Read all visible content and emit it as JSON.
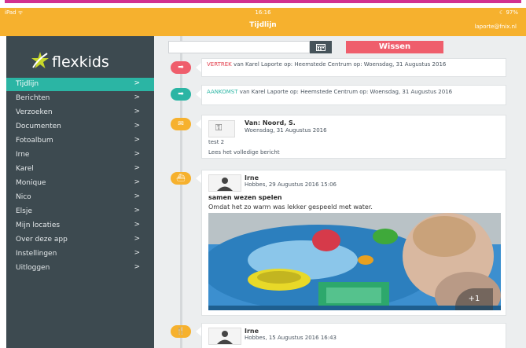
{
  "status": {
    "left": "iPad ᯤ",
    "time": "16:16",
    "right": "☾ 97%"
  },
  "header": {
    "title": "Tijdlijn",
    "email": "laporte@fnix.nl"
  },
  "brand": {
    "name": "flexkids",
    "star_color": "#c8d82a"
  },
  "nav": {
    "items": [
      {
        "label": "Tijdlijn",
        "active": true
      },
      {
        "label": "Berichten"
      },
      {
        "label": "Verzoeken"
      },
      {
        "label": "Documenten"
      },
      {
        "label": "Fotoalbum"
      },
      {
        "label": "Irne"
      },
      {
        "label": "Karel"
      },
      {
        "label": "Monique"
      },
      {
        "label": "Nico"
      },
      {
        "label": "Elsje"
      },
      {
        "label": "Mijn locaties"
      },
      {
        "label": "Over deze app"
      },
      {
        "label": "Instellingen"
      },
      {
        "label": "Uitloggen"
      }
    ],
    "chevron": ">"
  },
  "filter": {
    "date_value": "",
    "calendar_icon": "calendar-icon",
    "clear_label": "Wissen"
  },
  "timeline": {
    "vertrek": {
      "keyword": "VERTREK",
      "text": " van Karel Laporte op: Heemstede Centrum op: Woensdag, 31 Augustus 2016"
    },
    "aankomst": {
      "keyword": "AANKOMST",
      "text": " van Karel Laporte op: Heemstede Centrum op: Woensdag, 31 Augustus 2016"
    },
    "message": {
      "from": "Van: Noord, S.",
      "date": "Woensdag, 31 Augustus 2016",
      "body": "test 2",
      "link": "Lees het volledige bericht"
    },
    "post1": {
      "author": "Irne",
      "meta": "Hobbes, 29 Augustus 2016 15:06",
      "title": "samen wezen spelen",
      "text": "Omdat het zo warm was lekker gespeeld met water.",
      "more_photos": "+1"
    },
    "post2": {
      "author": "Irne",
      "meta": "Hobbes, 15 Augustus 2016 16:43"
    }
  },
  "colors": {
    "accent": "#f6b12e",
    "teal": "#2bb5a4",
    "red": "#ef5e6c",
    "sidebar": "#3d4a50"
  }
}
